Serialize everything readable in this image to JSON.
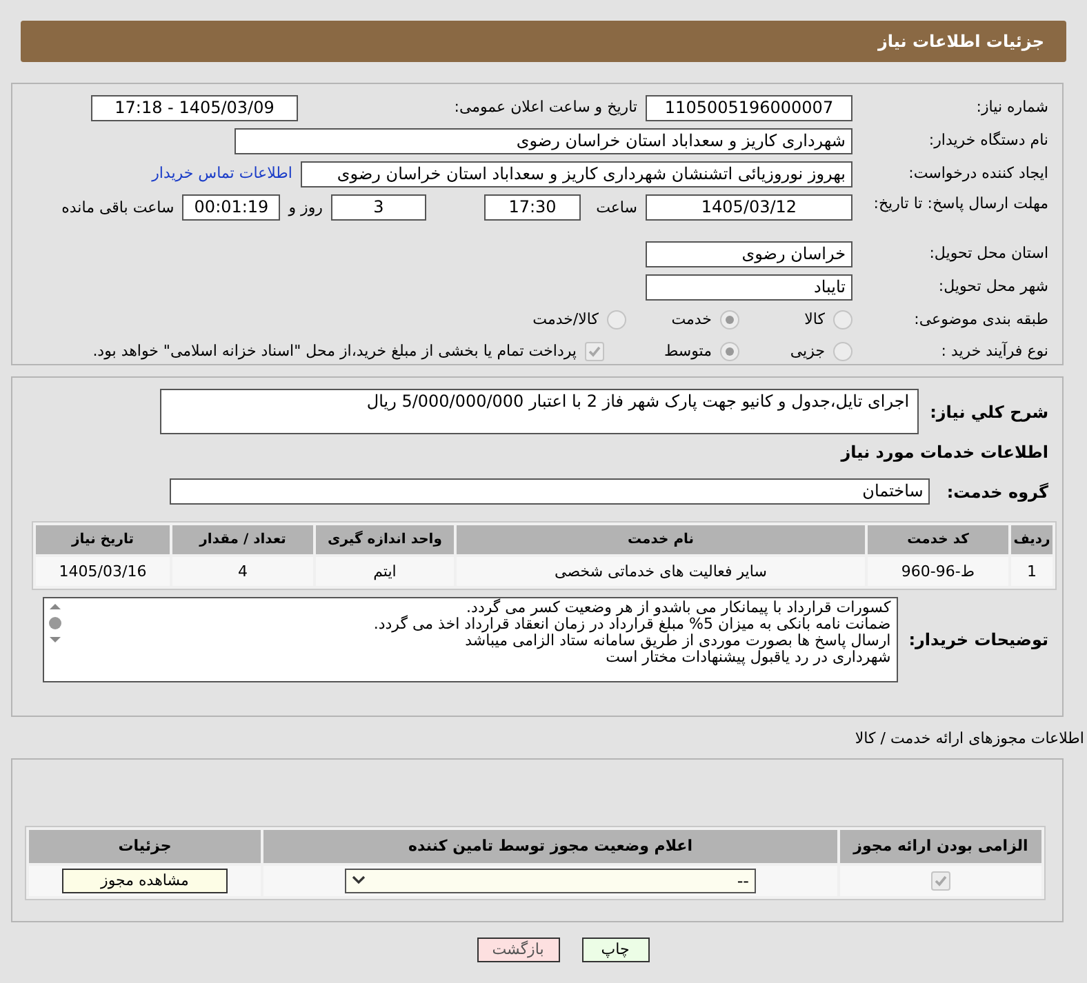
{
  "header": {
    "title": "جزئیات اطلاعات نیاز"
  },
  "need_number": {
    "label": "شماره نیاز:",
    "value": "1105005196000007"
  },
  "announce": {
    "label": "تاریخ و ساعت اعلان عمومی:",
    "value": "1405/03/09 - 17:18"
  },
  "buyer_org": {
    "label": "نام دستگاه خریدار:",
    "value": "شهرداری کاریز و سعداباد استان خراسان رضوی"
  },
  "requester": {
    "label": "ایجاد کننده درخواست:",
    "value": "بهروز نوروزیائی اتشنشان شهرداری کاریز و سعداباد استان خراسان رضوی",
    "link": "اطلاعات تماس خریدار"
  },
  "deadline": {
    "label": "مهلت ارسال پاسخ: تا تاریخ:",
    "date": "1405/03/12",
    "time_label": "ساعت",
    "time": "17:30",
    "days": "3",
    "days_label": "روز و",
    "remaining": "00:01:19",
    "remaining_label": "ساعت باقی مانده"
  },
  "province": {
    "label": "استان محل تحویل:",
    "value": "خراسان رضوی"
  },
  "city": {
    "label": "شهر محل تحویل:",
    "value": "تایباد"
  },
  "category": {
    "label": "طبقه بندی موضوعی:",
    "options": [
      {
        "label": "کالا",
        "selected": false
      },
      {
        "label": "خدمت",
        "selected": true
      },
      {
        "label": "کالا/خدمت",
        "selected": false
      }
    ]
  },
  "process": {
    "label": "نوع فرآیند خرید :",
    "options": [
      {
        "label": "جزیی",
        "selected": false
      },
      {
        "label": "متوسط",
        "selected": true
      }
    ],
    "treasury": {
      "label": "پرداخت تمام یا بخشی از مبلغ خرید،از محل \"اسناد خزانه اسلامی\" خواهد بود.",
      "checked": true
    }
  },
  "description": {
    "label": "شرح کلي نياز:",
    "value": "اجرای تایل،جدول و کانیو جهت پارک شهر فاز 2 با اعتبار 5/000/000/000 ریال"
  },
  "services_title": "اطلاعات خدمات مورد نیاز",
  "service_group": {
    "label": "گروه خدمت:",
    "value": "ساختمان"
  },
  "services_table": {
    "columns": [
      "ردیف",
      "کد خدمت",
      "نام خدمت",
      "واحد اندازه گیری",
      "تعداد / مقدار",
      "تاریخ نیاز"
    ],
    "rows": [
      [
        "1",
        "ط-96-960",
        "سایر فعالیت های خدماتی شخصی",
        "ایتم",
        "4",
        "1405/03/16"
      ]
    ]
  },
  "buyer_notes": {
    "label": "توضیحات خریدار:",
    "lines": [
      "کسورات قرارداد با پیمانکار می باشدو از هر وضعیت کسر می گردد.",
      "ضمانت نامه بانکی به میزان 5% مبلغ قرارداد در زمان انعقاد قرارداد اخذ می گردد.",
      "ارسال پاسخ ها بصورت موردی از طریق سامانه ستاد الزامی میباشد",
      "شهرداری در رد یاقبول پیشنهادات مختار است"
    ]
  },
  "permits_title": "اطلاعات مجوزهای ارائه خدمت / کالا",
  "permits_table": {
    "columns": [
      "الزامی بودن ارائه مجوز",
      "اعلام وضعیت مجوز توسط تامین کننده",
      "جزئیات"
    ],
    "rows": [
      {
        "required": true,
        "status": "--",
        "action": "مشاهده مجوز"
      }
    ]
  },
  "buttons": [
    {
      "label": "چاپ",
      "kind": "print"
    },
    {
      "label": "بازگشت",
      "kind": "back"
    }
  ]
}
